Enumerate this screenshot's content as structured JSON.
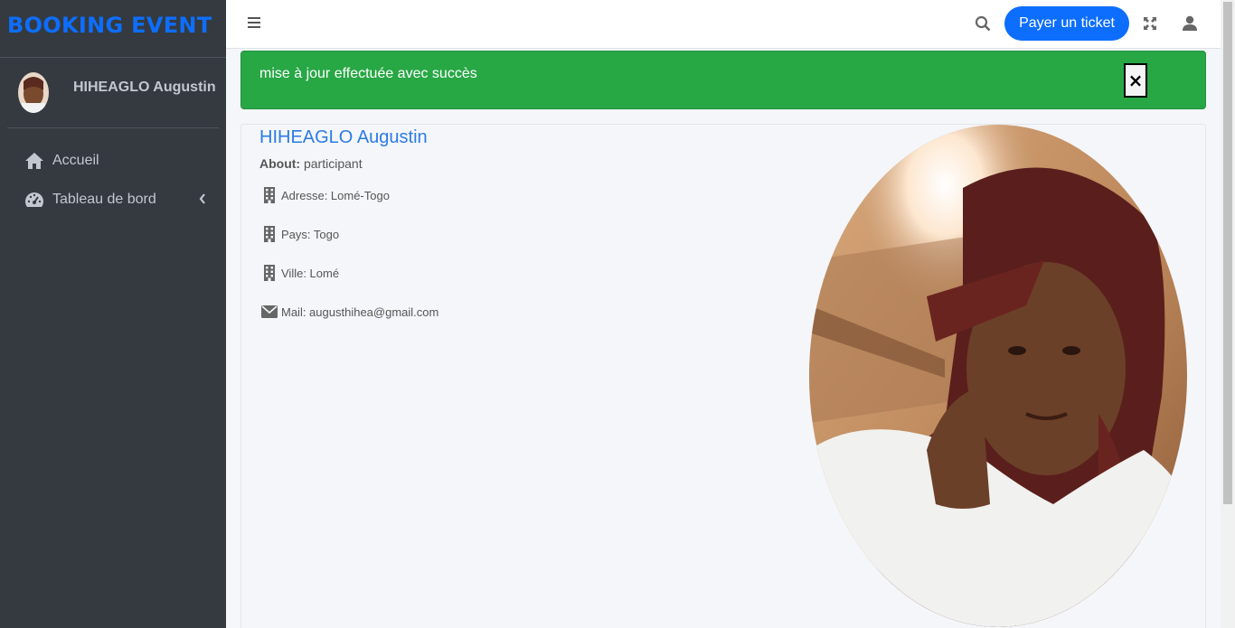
{
  "sidebar": {
    "brand": "BOOKING EVENT",
    "user_name": "HIHEAGLO Augustin",
    "items": [
      {
        "label": "Accueil",
        "icon": "home-icon"
      },
      {
        "label": "Tableau de bord",
        "icon": "tachometer-icon"
      }
    ]
  },
  "header": {
    "pay_button": "Payer un ticket"
  },
  "alert": {
    "message": "mise à jour effectuée avec succès",
    "close": "×"
  },
  "profile": {
    "name": "HIHEAGLO Augustin",
    "about_label": "About:",
    "about_value": "participant",
    "fields": [
      {
        "text": "Adresse: Lomé-Togo",
        "icon": "building-icon"
      },
      {
        "text": "Pays: Togo",
        "icon": "building-icon"
      },
      {
        "text": "Ville: Lomé",
        "icon": "building-icon"
      },
      {
        "text": "Mail: augusthihea@gmail.com",
        "icon": "envelope-icon"
      }
    ]
  },
  "colors": {
    "sidebar_bg": "#343a40",
    "brand": "#0d6efd",
    "alert_success": "#28a745",
    "primary_button": "#0d6efd",
    "profile_name": "#2c7be5"
  }
}
